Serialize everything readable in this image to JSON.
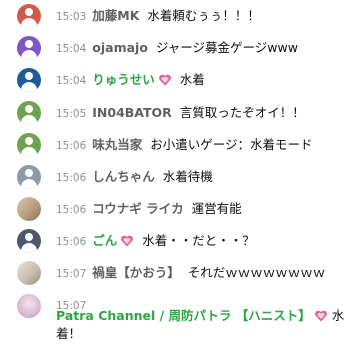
{
  "messages": [
    {
      "time": "15:03",
      "author": "加藤MK",
      "author_green": false,
      "badge": false,
      "text": "水着頼むぅぅ！！！",
      "avatar_color": "#d05a4e"
    },
    {
      "time": "15:04",
      "author": "ojamajo",
      "author_green": false,
      "badge": false,
      "text": "ジャージ募金ゲージwww",
      "avatar_color": "#7e57c2"
    },
    {
      "time": "15:04",
      "author": "りゅうせい",
      "author_green": true,
      "badge": true,
      "text": "水着",
      "avatar_color": "#1e5c9c"
    },
    {
      "time": "15:05",
      "author": "IN04BATOR",
      "author_green": false,
      "badge": false,
      "text": "言質取ったぞオイ！！",
      "avatar_color": "#6ea24e"
    },
    {
      "time": "15:06",
      "author": "味丸当家",
      "author_green": false,
      "badge": false,
      "text": "お小遣いゲージ：水着モード",
      "avatar_color": "#6ea24e"
    },
    {
      "time": "15:06",
      "author": "しんちゃん",
      "author_green": false,
      "badge": false,
      "text": "水着待機",
      "avatar_color": "#8a9aa6"
    },
    {
      "time": "15:06",
      "author": "コウナギ ライカ",
      "author_green": false,
      "badge": false,
      "text": "運営有能",
      "avatar_color": "photo1"
    },
    {
      "time": "15:06",
      "author": "ごん",
      "author_green": true,
      "badge": true,
      "text": "水着・・だと・・？",
      "avatar_color": "#4a5a68"
    },
    {
      "time": "15:07",
      "author": "禍皇【かおう】",
      "author_green": false,
      "badge": false,
      "text": "それだｗｗｗｗｗｗｗｗ",
      "avatar_color": "photo2"
    }
  ],
  "last_message": {
    "time": "15:07",
    "author": "Patra Channel / 周防パトラ 【ハニスト】",
    "text": "水着！",
    "avatar_color": "photo3"
  },
  "colors": {
    "member_green": "#2ba640",
    "badge_pink": "#e35b8f"
  }
}
